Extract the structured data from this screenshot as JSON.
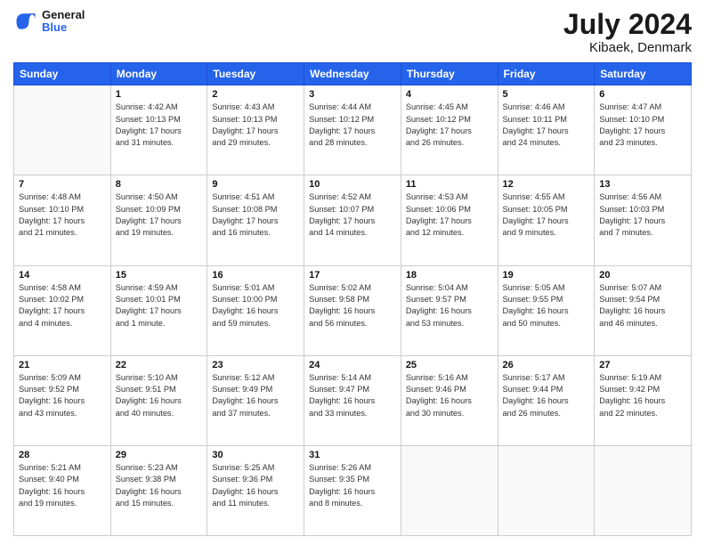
{
  "header": {
    "logo_line1": "General",
    "logo_line2": "Blue",
    "title": "July 2024",
    "subtitle": "Kibaek, Denmark"
  },
  "days_of_week": [
    "Sunday",
    "Monday",
    "Tuesday",
    "Wednesday",
    "Thursday",
    "Friday",
    "Saturday"
  ],
  "weeks": [
    [
      {
        "day": "",
        "info": ""
      },
      {
        "day": "1",
        "info": "Sunrise: 4:42 AM\nSunset: 10:13 PM\nDaylight: 17 hours\nand 31 minutes."
      },
      {
        "day": "2",
        "info": "Sunrise: 4:43 AM\nSunset: 10:13 PM\nDaylight: 17 hours\nand 29 minutes."
      },
      {
        "day": "3",
        "info": "Sunrise: 4:44 AM\nSunset: 10:12 PM\nDaylight: 17 hours\nand 28 minutes."
      },
      {
        "day": "4",
        "info": "Sunrise: 4:45 AM\nSunset: 10:12 PM\nDaylight: 17 hours\nand 26 minutes."
      },
      {
        "day": "5",
        "info": "Sunrise: 4:46 AM\nSunset: 10:11 PM\nDaylight: 17 hours\nand 24 minutes."
      },
      {
        "day": "6",
        "info": "Sunrise: 4:47 AM\nSunset: 10:10 PM\nDaylight: 17 hours\nand 23 minutes."
      }
    ],
    [
      {
        "day": "7",
        "info": "Sunrise: 4:48 AM\nSunset: 10:10 PM\nDaylight: 17 hours\nand 21 minutes."
      },
      {
        "day": "8",
        "info": "Sunrise: 4:50 AM\nSunset: 10:09 PM\nDaylight: 17 hours\nand 19 minutes."
      },
      {
        "day": "9",
        "info": "Sunrise: 4:51 AM\nSunset: 10:08 PM\nDaylight: 17 hours\nand 16 minutes."
      },
      {
        "day": "10",
        "info": "Sunrise: 4:52 AM\nSunset: 10:07 PM\nDaylight: 17 hours\nand 14 minutes."
      },
      {
        "day": "11",
        "info": "Sunrise: 4:53 AM\nSunset: 10:06 PM\nDaylight: 17 hours\nand 12 minutes."
      },
      {
        "day": "12",
        "info": "Sunrise: 4:55 AM\nSunset: 10:05 PM\nDaylight: 17 hours\nand 9 minutes."
      },
      {
        "day": "13",
        "info": "Sunrise: 4:56 AM\nSunset: 10:03 PM\nDaylight: 17 hours\nand 7 minutes."
      }
    ],
    [
      {
        "day": "14",
        "info": "Sunrise: 4:58 AM\nSunset: 10:02 PM\nDaylight: 17 hours\nand 4 minutes."
      },
      {
        "day": "15",
        "info": "Sunrise: 4:59 AM\nSunset: 10:01 PM\nDaylight: 17 hours\nand 1 minute."
      },
      {
        "day": "16",
        "info": "Sunrise: 5:01 AM\nSunset: 10:00 PM\nDaylight: 16 hours\nand 59 minutes."
      },
      {
        "day": "17",
        "info": "Sunrise: 5:02 AM\nSunset: 9:58 PM\nDaylight: 16 hours\nand 56 minutes."
      },
      {
        "day": "18",
        "info": "Sunrise: 5:04 AM\nSunset: 9:57 PM\nDaylight: 16 hours\nand 53 minutes."
      },
      {
        "day": "19",
        "info": "Sunrise: 5:05 AM\nSunset: 9:55 PM\nDaylight: 16 hours\nand 50 minutes."
      },
      {
        "day": "20",
        "info": "Sunrise: 5:07 AM\nSunset: 9:54 PM\nDaylight: 16 hours\nand 46 minutes."
      }
    ],
    [
      {
        "day": "21",
        "info": "Sunrise: 5:09 AM\nSunset: 9:52 PM\nDaylight: 16 hours\nand 43 minutes."
      },
      {
        "day": "22",
        "info": "Sunrise: 5:10 AM\nSunset: 9:51 PM\nDaylight: 16 hours\nand 40 minutes."
      },
      {
        "day": "23",
        "info": "Sunrise: 5:12 AM\nSunset: 9:49 PM\nDaylight: 16 hours\nand 37 minutes."
      },
      {
        "day": "24",
        "info": "Sunrise: 5:14 AM\nSunset: 9:47 PM\nDaylight: 16 hours\nand 33 minutes."
      },
      {
        "day": "25",
        "info": "Sunrise: 5:16 AM\nSunset: 9:46 PM\nDaylight: 16 hours\nand 30 minutes."
      },
      {
        "day": "26",
        "info": "Sunrise: 5:17 AM\nSunset: 9:44 PM\nDaylight: 16 hours\nand 26 minutes."
      },
      {
        "day": "27",
        "info": "Sunrise: 5:19 AM\nSunset: 9:42 PM\nDaylight: 16 hours\nand 22 minutes."
      }
    ],
    [
      {
        "day": "28",
        "info": "Sunrise: 5:21 AM\nSunset: 9:40 PM\nDaylight: 16 hours\nand 19 minutes."
      },
      {
        "day": "29",
        "info": "Sunrise: 5:23 AM\nSunset: 9:38 PM\nDaylight: 16 hours\nand 15 minutes."
      },
      {
        "day": "30",
        "info": "Sunrise: 5:25 AM\nSunset: 9:36 PM\nDaylight: 16 hours\nand 11 minutes."
      },
      {
        "day": "31",
        "info": "Sunrise: 5:26 AM\nSunset: 9:35 PM\nDaylight: 16 hours\nand 8 minutes."
      },
      {
        "day": "",
        "info": ""
      },
      {
        "day": "",
        "info": ""
      },
      {
        "day": "",
        "info": ""
      }
    ]
  ]
}
